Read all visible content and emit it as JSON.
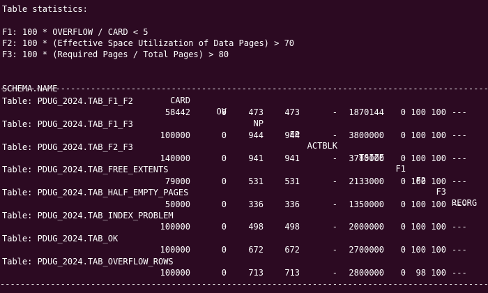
{
  "terminal": {
    "heading": "Table statistics:",
    "legend": [
      "F1: 100 * OVERFLOW / CARD < 5",
      "F2: 100 * (Effective Space Utilization of Data Pages) > 70",
      "F3: 100 * (Required Pages / Total Pages) > 80"
    ],
    "columns": {
      "schema_name": "SCHEMA.NAME",
      "card": "CARD",
      "ov": "OV",
      "np": "NP",
      "fp": "FP",
      "actblk": "ACTBLK",
      "tsize": "TSIZE",
      "f1": "F1",
      "f2": "F2",
      "f3": "F3",
      "reorg": "REORG"
    },
    "separator": "--------------------------------------------------------------------------------------------------------------",
    "rows": [
      {
        "table": "Table: PDUG_2024.TAB_F1_F2",
        "card": "58442",
        "ov": "0",
        "np": "473",
        "fp": "473",
        "actblk": "-",
        "tsize": "1870144",
        "f1": "0",
        "f2": "100",
        "f3": "100",
        "reorg": "---"
      },
      {
        "table": "Table: PDUG_2024.TAB_F1_F3",
        "card": "100000",
        "ov": "0",
        "np": "944",
        "fp": "944",
        "actblk": "-",
        "tsize": "3800000",
        "f1": "0",
        "f2": "100",
        "f3": "100",
        "reorg": "---"
      },
      {
        "table": "Table: PDUG_2024.TAB_F2_F3",
        "card": "140000",
        "ov": "0",
        "np": "941",
        "fp": "941",
        "actblk": "-",
        "tsize": "3780000",
        "f1": "0",
        "f2": "100",
        "f3": "100",
        "reorg": "---"
      },
      {
        "table": "Table: PDUG_2024.TAB_FREE_EXTENTS",
        "card": "79000",
        "ov": "0",
        "np": "531",
        "fp": "531",
        "actblk": "-",
        "tsize": "2133000",
        "f1": "0",
        "f2": "100",
        "f3": "100",
        "reorg": "---"
      },
      {
        "table": "Table: PDUG_2024.TAB_HALF_EMPTY_PAGES",
        "card": "50000",
        "ov": "0",
        "np": "336",
        "fp": "336",
        "actblk": "-",
        "tsize": "1350000",
        "f1": "0",
        "f2": "100",
        "f3": "100",
        "reorg": "---"
      },
      {
        "table": "Table: PDUG_2024.TAB_INDEX_PROBLEM",
        "card": "100000",
        "ov": "0",
        "np": "498",
        "fp": "498",
        "actblk": "-",
        "tsize": "2000000",
        "f1": "0",
        "f2": "100",
        "f3": "100",
        "reorg": "---"
      },
      {
        "table": "Table: PDUG_2024.TAB_OK",
        "card": "100000",
        "ov": "0",
        "np": "672",
        "fp": "672",
        "actblk": "-",
        "tsize": "2700000",
        "f1": "0",
        "f2": "100",
        "f3": "100",
        "reorg": "---"
      },
      {
        "table": "Table: PDUG_2024.TAB_OVERFLOW_ROWS",
        "card": "100000",
        "ov": "0",
        "np": "713",
        "fp": "713",
        "actblk": "-",
        "tsize": "2800000",
        "f1": "0",
        "f2": "98",
        "f3": "100",
        "reorg": "---"
      }
    ],
    "colors": {
      "background": "#2c0a22",
      "foreground": "#ffffff"
    }
  }
}
